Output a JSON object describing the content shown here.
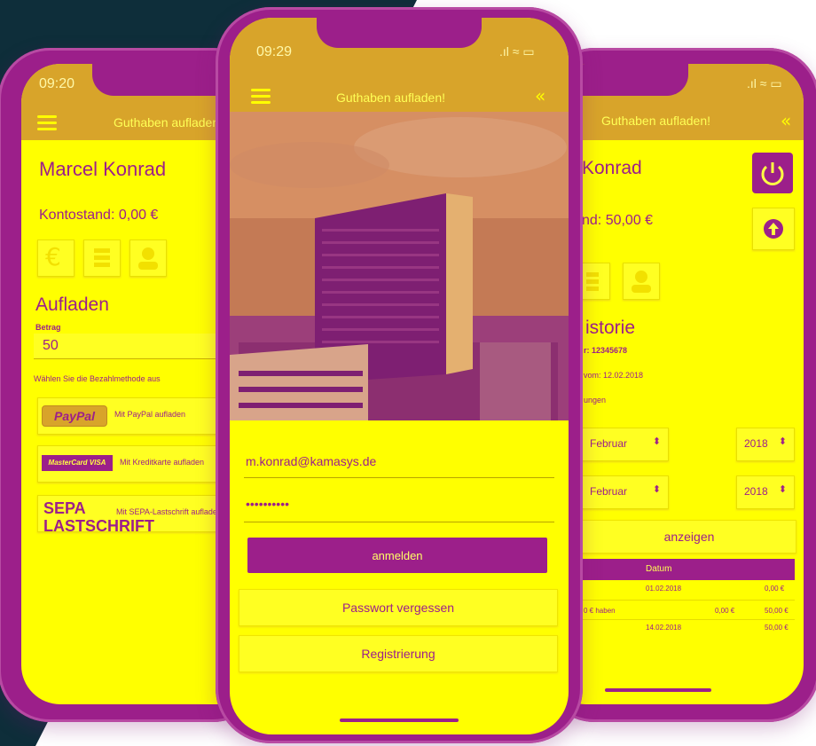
{
  "colors": {
    "primary": "#9c1f8a",
    "screen": "#ffff00",
    "appbar": "#d8a42a",
    "dark": "#0e2e3a"
  },
  "left_phone": {
    "time": "09:20",
    "title": "Guthaben aufladen!",
    "name": "Marcel Konrad",
    "balance": "Kontostand: 0,00 €",
    "icons": [
      "euro-icon",
      "list-icon",
      "person-icon"
    ],
    "section": "Aufladen",
    "amount_label": "Betrag",
    "amount_value": "50",
    "method_prompt": "Wählen Sie die Bezahlmethode aus",
    "methods": [
      {
        "logo": "PayPal",
        "label": "Mit PayPal aufladen"
      },
      {
        "logo": "MasterCard VISA",
        "label": "Mit Kreditkarte aufladen"
      },
      {
        "logo": "SEPA LASTSCHRIFT",
        "label": "Mit SEPA-Lastschrift aufladen"
      }
    ]
  },
  "center_phone": {
    "time": "09:29",
    "title": "Guthaben aufladen!",
    "email": "m.konrad@kamasys.de",
    "password": "••••••••••",
    "login_label": "anmelden",
    "forgot_label": "Passwort vergessen",
    "register_label": "Registrierung"
  },
  "right_phone": {
    "title": "Guthaben aufladen!",
    "name": "Konrad",
    "balance": "nd: 50,00 €",
    "section": "istorie",
    "number_line": "r: 12345678",
    "date_line": "vom: 12.02.2018",
    "bookings": "ungen",
    "from_month": "Februar",
    "from_year": "2018",
    "to_month": "Februar",
    "to_year": "2018",
    "show_label": "anzeigen",
    "table_header": "Datum",
    "rows": [
      {
        "date": "01.02.2018",
        "c1": "",
        "c2": "",
        "c3": "0,00 €"
      },
      {
        "date": "",
        "c0": "0 € haben",
        "c2": "0,00 €",
        "c3": "50,00 €"
      },
      {
        "date": "14.02.2018",
        "c1": "",
        "c2": "",
        "c3": "50,00 €"
      }
    ]
  }
}
